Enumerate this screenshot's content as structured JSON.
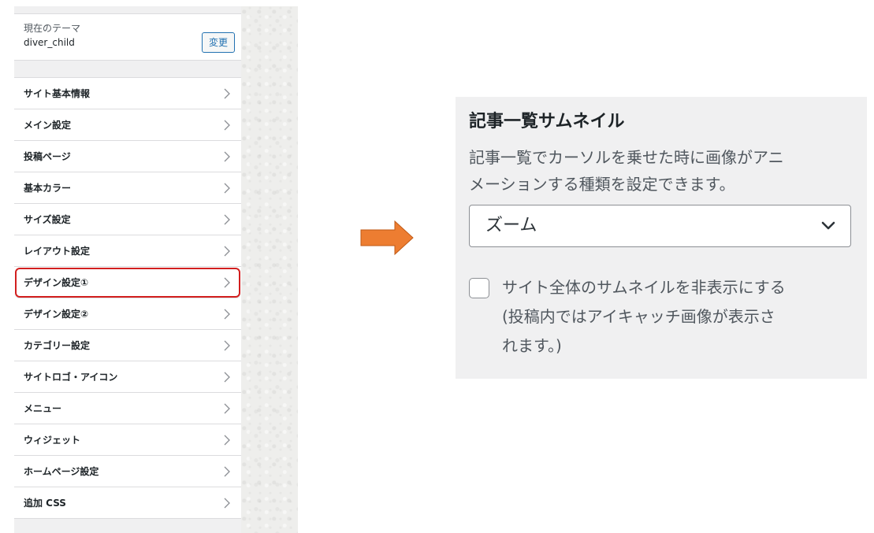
{
  "theme": {
    "caption": "現在のテーマ",
    "name": "diver_child",
    "change_label": "変更"
  },
  "menu": {
    "items": [
      {
        "label": "サイト基本情報"
      },
      {
        "label": "メイン設定"
      },
      {
        "label": "投稿ページ"
      },
      {
        "label": "基本カラー"
      },
      {
        "label": "サイズ設定"
      },
      {
        "label": "レイアウト設定"
      },
      {
        "label": "デザイン設定①"
      },
      {
        "label": "デザイン設定②"
      },
      {
        "label": "カテゴリー設定"
      },
      {
        "label": "サイトロゴ・アイコン"
      },
      {
        "label": "メニュー"
      },
      {
        "label": "ウィジェット"
      },
      {
        "label": "ホームページ設定"
      },
      {
        "label": "追加 CSS"
      }
    ],
    "highlighted_item": "デザイン設定①",
    "highlight_color": "#d21f1f"
  },
  "arrow": {
    "color": "#ed7d31",
    "icon": "right-arrow-icon"
  },
  "setting": {
    "title": "記事一覧サムネイル",
    "description_line1": "記事一覧でカーソルを乗せた時に画像がアニ",
    "description_line2": "メーションする種類を設定できます。",
    "select_value": "ズーム",
    "checkbox_checked": false,
    "checkbox_line1": "サイト全体のサムネイルを非表示にする",
    "checkbox_line2": "(投稿内ではアイキャッチ画像が表示さ",
    "checkbox_line3": "れます。)"
  }
}
